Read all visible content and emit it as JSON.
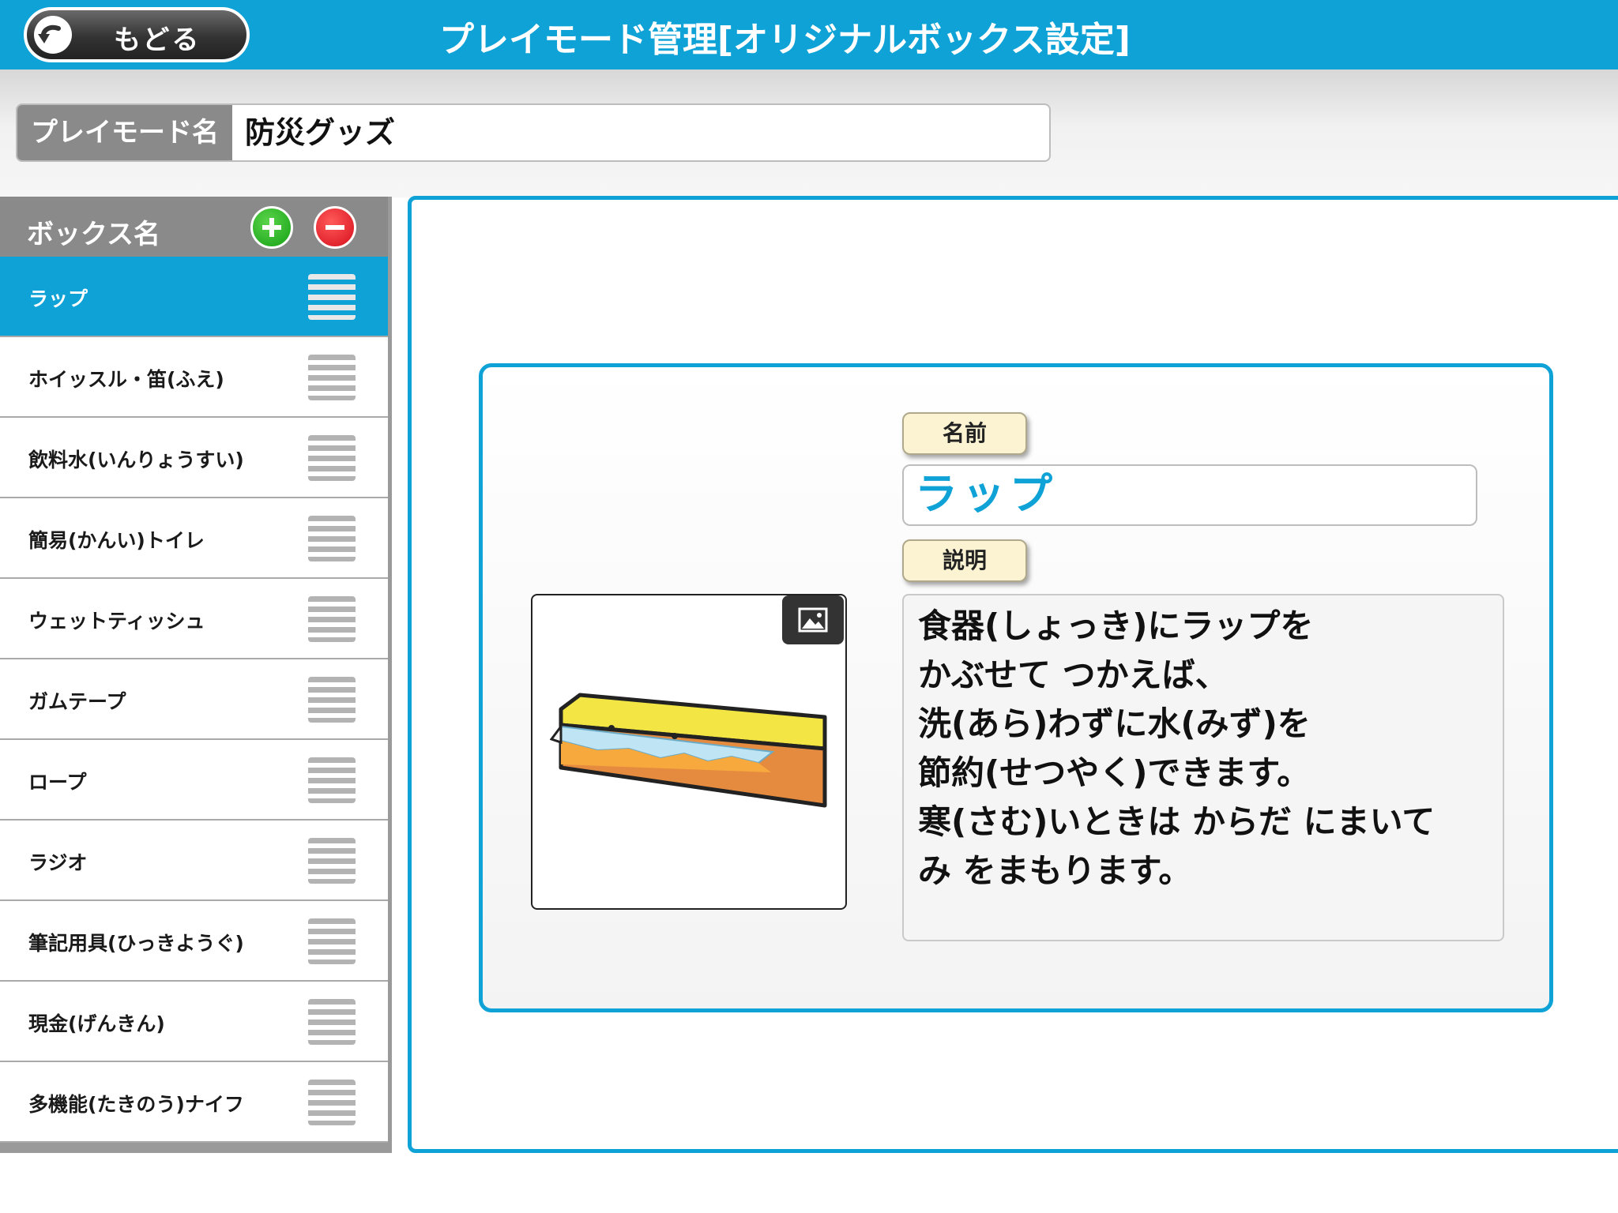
{
  "header": {
    "back_label": "もどる",
    "title": "プレイモード管理[オリジナルボックス設定]"
  },
  "play_mode": {
    "label": "プレイモード名",
    "value": "防災グッズ"
  },
  "sidebar": {
    "title": "ボックス名",
    "items": [
      {
        "label": "ラップ",
        "selected": true
      },
      {
        "label": "ホイッスル・笛(ふえ)",
        "selected": false
      },
      {
        "label": "飲料水(いんりょうすい)",
        "selected": false
      },
      {
        "label": "簡易(かんい)トイレ",
        "selected": false
      },
      {
        "label": "ウェットティッシュ",
        "selected": false
      },
      {
        "label": "ガムテープ",
        "selected": false
      },
      {
        "label": "ロープ",
        "selected": false
      },
      {
        "label": "ラジオ",
        "selected": false
      },
      {
        "label": "筆記用具(ひっきようぐ)",
        "selected": false
      },
      {
        "label": "現金(げんきん)",
        "selected": false
      },
      {
        "label": "多機能(たきのう)ナイフ",
        "selected": false
      }
    ]
  },
  "detail": {
    "name_label": "名前",
    "name_value": "ラップ",
    "description_label": "説明",
    "description_lines": [
      "食器(しょっき)にラップを",
      "かぶせて つかえば、",
      "洗(あら)わずに水(みず)を",
      "節約(せつやく)できます。",
      "寒(さむ)いときは からだ にまいて",
      "み をまもります。"
    ]
  },
  "colors": {
    "accent": "#0ea2d6",
    "add": "#15a115",
    "remove": "#d60e1b"
  },
  "icons": {
    "back": "back-arrow-icon",
    "add": "plus-icon",
    "remove": "minus-icon",
    "drag": "drag-handle-icon",
    "image": "image-icon"
  }
}
